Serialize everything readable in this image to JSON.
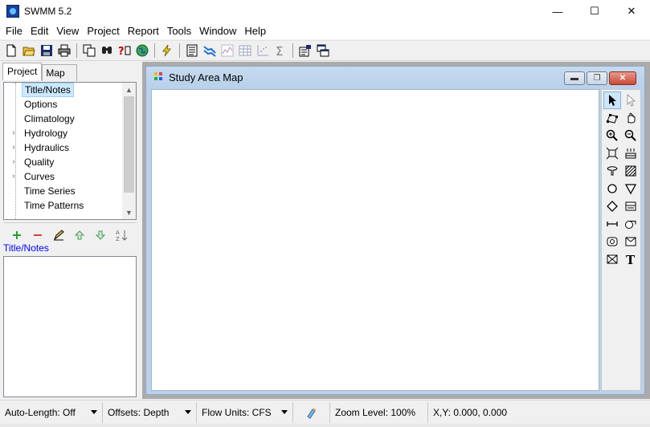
{
  "window": {
    "title": "SWMM 5.2",
    "minimize_glyph": "—",
    "maximize_glyph": "☐",
    "close_glyph": "✕"
  },
  "menu": [
    "File",
    "Edit",
    "View",
    "Project",
    "Report",
    "Tools",
    "Window",
    "Help"
  ],
  "toolbar": {
    "icons": [
      "new-file-icon",
      "open-folder-icon",
      "save-icon",
      "print-icon",
      "copy-icon",
      "find-icon",
      "query-icon",
      "overview-map-icon",
      "run-simulation-icon",
      "status-report-icon",
      "profile-plot-icon",
      "time-series-plot-icon",
      "table-icon",
      "scatter-plot-icon",
      "statistics-icon",
      "options-icon",
      "arrange-windows-icon"
    ]
  },
  "browser": {
    "tabs": [
      "Project",
      "Map"
    ],
    "active_tab": "Project",
    "tree_items": [
      {
        "label": "Title/Notes",
        "expandable": false,
        "selected": true
      },
      {
        "label": "Options",
        "expandable": false,
        "selected": false
      },
      {
        "label": "Climatology",
        "expandable": false,
        "selected": false
      },
      {
        "label": "Hydrology",
        "expandable": true,
        "selected": false
      },
      {
        "label": "Hydraulics",
        "expandable": true,
        "selected": false
      },
      {
        "label": "Quality",
        "expandable": true,
        "selected": false
      },
      {
        "label": "Curves",
        "expandable": true,
        "selected": false
      },
      {
        "label": "Time Series",
        "expandable": false,
        "selected": false
      },
      {
        "label": "Time Patterns",
        "expandable": false,
        "selected": false
      }
    ],
    "selected_object_label": "Title/Notes",
    "object_tools": [
      "add-icon",
      "delete-icon",
      "edit-icon",
      "move-up-icon",
      "move-down-icon",
      "sort-icon"
    ]
  },
  "map_window": {
    "title": "Study Area Map",
    "minimize_glyph": "▬",
    "restore_glyph": "❐",
    "close_glyph": "✕",
    "tools": [
      "select-object-icon",
      "select-vertex-icon",
      "select-region-icon",
      "pan-icon",
      "zoom-in-icon",
      "zoom-out-icon",
      "full-extent-icon",
      "rain-gage-icon",
      "subcatchment-icon",
      "junction-icon",
      "outfall-icon",
      "divider-icon",
      "storage-unit-icon",
      "conduit-icon",
      "pump-icon",
      "orifice-icon",
      "weir-icon",
      "outlet-icon",
      "label-text-icon"
    ]
  },
  "status": {
    "auto_length": "Auto-Length: Off",
    "offsets": "Offsets: Depth",
    "flow_units": "Flow Units: CFS",
    "zoom_level": "Zoom Level: 100%",
    "xy": "X,Y: 0.000, 0.000"
  },
  "colors": {
    "selected_background": "#cce8ff",
    "map_frame": "#b9d1ea",
    "object_label": "#0000ff"
  }
}
